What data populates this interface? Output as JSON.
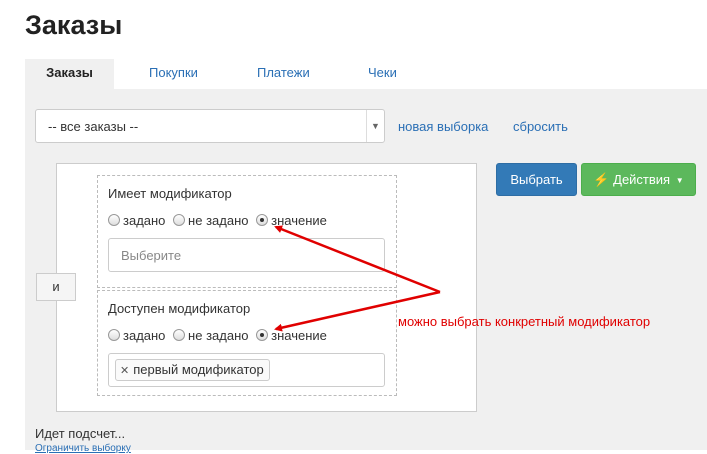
{
  "page": {
    "title": "Заказы"
  },
  "tabs": [
    {
      "label": "Заказы",
      "active": true
    },
    {
      "label": "Покупки",
      "active": false
    },
    {
      "label": "Платежи",
      "active": false
    },
    {
      "label": "Чеки",
      "active": false
    }
  ],
  "filter": {
    "select_value": "-- все заказы --",
    "new_selection_link": "новая выборка",
    "reset_link": "сбросить",
    "and_label": "и",
    "conditions": [
      {
        "title": "Имеет модификатор",
        "options": [
          "задано",
          "не задано",
          "значение"
        ],
        "selected": "значение",
        "input_placeholder": "Выберите"
      },
      {
        "title": "Доступен модификатор",
        "options": [
          "задано",
          "не задано",
          "значение"
        ],
        "selected": "значение",
        "chip": "первый модификатор"
      }
    ]
  },
  "buttons": {
    "select": "Выбрать",
    "actions": "Действия"
  },
  "status": {
    "counting": "Идет подсчет...",
    "limit_link": "Ограничить выборку"
  },
  "annotation": {
    "text": "можно выбрать конкретный модификатор",
    "color": "#e00000"
  },
  "colors": {
    "primary": "#337ab7",
    "success": "#5cb85c",
    "link": "#2a6fb5"
  }
}
